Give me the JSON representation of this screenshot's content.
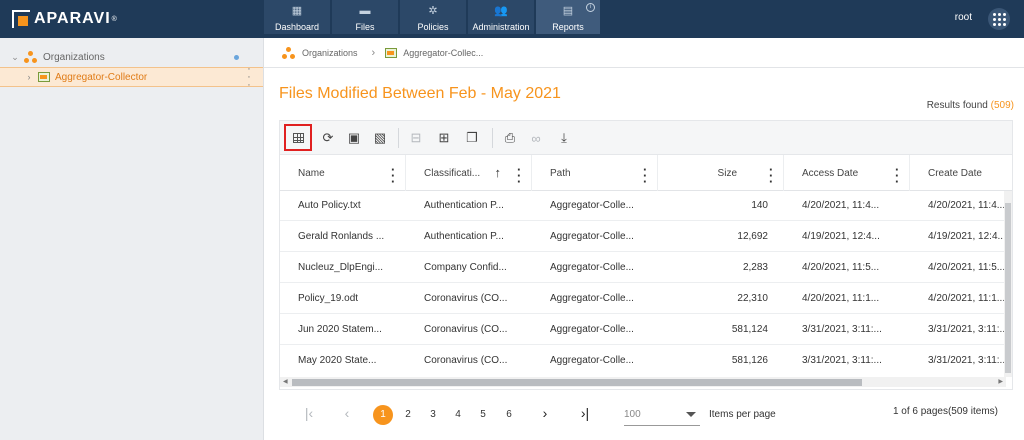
{
  "app": {
    "logo": "APARAVI",
    "logo_reg": "®",
    "user": "root"
  },
  "nav": [
    {
      "label": "Dashboard",
      "icon": "dashboard-icon"
    },
    {
      "label": "Files",
      "icon": "folder-icon"
    },
    {
      "label": "Policies",
      "icon": "gear-icon"
    },
    {
      "label": "Administration",
      "icon": "users-icon"
    },
    {
      "label": "Reports",
      "icon": "clipboard-icon",
      "active": true
    }
  ],
  "sidebar": {
    "items": [
      {
        "label": "Organizations",
        "caret": "⌄"
      },
      {
        "label": "Aggregator-Collector",
        "caret": "›",
        "selected": true
      }
    ]
  },
  "breadcrumb": {
    "items": [
      "Organizations",
      "Aggregator-Collec..."
    ]
  },
  "report": {
    "title": "Files Modified Between Feb - May 2021",
    "results_label": "Results found",
    "results_count": "(509)"
  },
  "table": {
    "columns": [
      "Name",
      "Classificati...",
      "Path",
      "Size",
      "Access Date",
      "Create Date"
    ],
    "rows": [
      [
        "Auto Policy.txt",
        "Authentication P...",
        "Aggregator-Colle...",
        "140",
        "4/20/2021, 11:4...",
        "4/20/2021, 11:4..."
      ],
      [
        "Gerald Ronlands ...",
        "Authentication P...",
        "Aggregator-Colle...",
        "12,692",
        "4/19/2021, 12:4...",
        "4/19/2021, 12:4..."
      ],
      [
        "Nucleuz_DlpEngi...",
        "Company Confid...",
        "Aggregator-Colle...",
        "2,283",
        "4/20/2021, 11:5...",
        "4/20/2021, 11:5..."
      ],
      [
        "Policy_19.odt",
        "Coronavirus (CO...",
        "Aggregator-Colle...",
        "22,310",
        "4/20/2021, 11:1...",
        "4/20/2021, 11:1..."
      ],
      [
        "Jun 2020 Statem...",
        "Coronavirus (CO...",
        "Aggregator-Colle...",
        "581,124",
        "3/31/2021, 3:11:...",
        "3/31/2021, 3:11:..."
      ],
      [
        "May 2020 State...",
        "Coronavirus (CO...",
        "Aggregator-Colle...",
        "581,126",
        "3/31/2021, 3:11:...",
        "3/31/2021, 3:11:..."
      ]
    ]
  },
  "pager": {
    "pages": [
      "1",
      "2",
      "3",
      "4",
      "5",
      "6"
    ],
    "current": "1",
    "per_page": "100",
    "per_page_label": "Items per page",
    "info": "1 of 6 pages(509 items)"
  },
  "colors": {
    "accent": "#f7941d",
    "topbar": "#1f3a58",
    "highlight": "#e02020"
  }
}
